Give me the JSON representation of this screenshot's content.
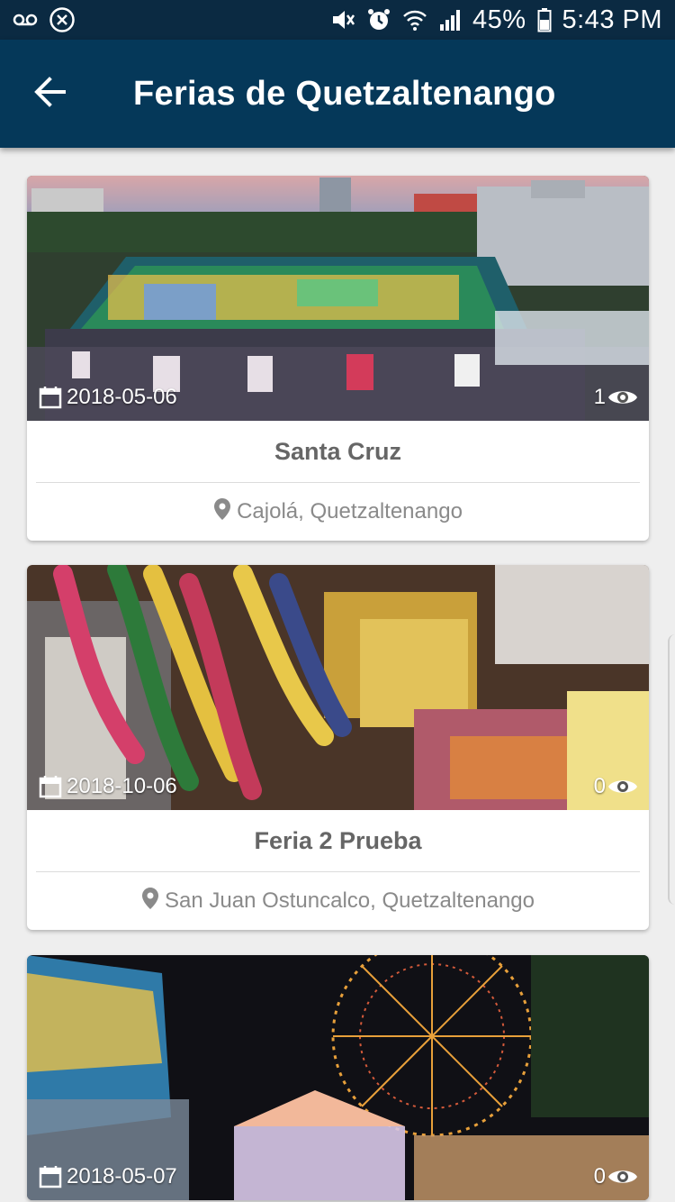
{
  "status_bar": {
    "battery": "45%",
    "time": "5:43 PM",
    "icons": [
      "voicemail-icon",
      "close-circle-icon",
      "mute-icon",
      "alarm-icon",
      "wifi-icon",
      "signal-icon",
      "battery-icon"
    ]
  },
  "app_bar": {
    "title": "Ferias de Quetzaltenango",
    "back_icon": "arrow-back-icon"
  },
  "cards": [
    {
      "date": "2018-05-06",
      "views": "1",
      "title": "Santa Cruz",
      "location": "Cajolá, Quetzaltenango"
    },
    {
      "date": "2018-10-06",
      "views": "0",
      "title": "Feria 2 Prueba",
      "location": "San Juan Ostuncalco, Quetzaltenango"
    },
    {
      "date": "2018-05-07",
      "views": "0",
      "title": "",
      "location": ""
    }
  ],
  "colors": {
    "status_bar": "#0b2a42",
    "app_bar": "#053859",
    "background": "#eeeeee",
    "card_text": "#666666",
    "location_text": "#8a8a8a"
  }
}
